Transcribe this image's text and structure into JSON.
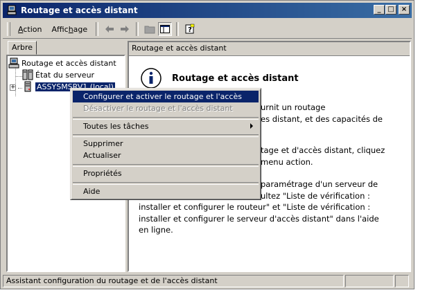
{
  "window": {
    "title": "Routage et accès distant",
    "controls": {
      "minimize": "_",
      "maximize": "□",
      "close": "×"
    }
  },
  "menubar": {
    "items": [
      {
        "label_prefix": "",
        "mnemonic": "A",
        "label_rest": "ction"
      },
      {
        "label_prefix": "Affic",
        "mnemonic": "h",
        "label_rest": "age"
      }
    ]
  },
  "toolbar": {
    "icons": [
      "back-arrow-icon",
      "forward-arrow-icon",
      "folder-up-icon",
      "show-hide-tree-icon",
      "help-icon"
    ]
  },
  "tree": {
    "tab_label": "Arbre",
    "nodes": [
      {
        "label": "Routage et accès distant"
      },
      {
        "label": "État du serveur"
      },
      {
        "label": "ASSYSMSRV1 (local)"
      }
    ]
  },
  "right": {
    "header": "Routage et accès distant",
    "title": "Routage et accès distant",
    "para1": [
      "urnit un routage",
      "es distant, et des capacités de"
    ],
    "para2": [
      "tage et d'accès distant, cliquez",
      "menu action."
    ],
    "para3": [
      "paramétrage d'un serveur de",
      "ultez \"Liste de vérification :",
      "installer et configurer le routeur\" et \"Liste de vérification :",
      "installer et configurer le serveur d'accès distant\" dans l'aide",
      "en ligne."
    ]
  },
  "context_menu": {
    "items": [
      {
        "label": "Configurer et activer le routage et l'accès distant",
        "state": "highlighted"
      },
      {
        "label": "Désactiver le routage et l'accès distant",
        "state": "disabled"
      },
      {
        "label": "Toutes les tâches",
        "state": "submenu"
      },
      {
        "label": "Supprimer",
        "state": "normal"
      },
      {
        "label": "Actualiser",
        "state": "normal"
      },
      {
        "label": "Propriétés",
        "state": "normal"
      },
      {
        "label": "Aide",
        "state": "normal"
      }
    ]
  },
  "statusbar": {
    "text": "Assistant configuration du routage et de l'accès distant"
  },
  "colors": {
    "titlebar_start": "#0a246a",
    "titlebar_end": "#3a6ea5",
    "selection": "#0a246a",
    "face": "#d4d0c8"
  }
}
